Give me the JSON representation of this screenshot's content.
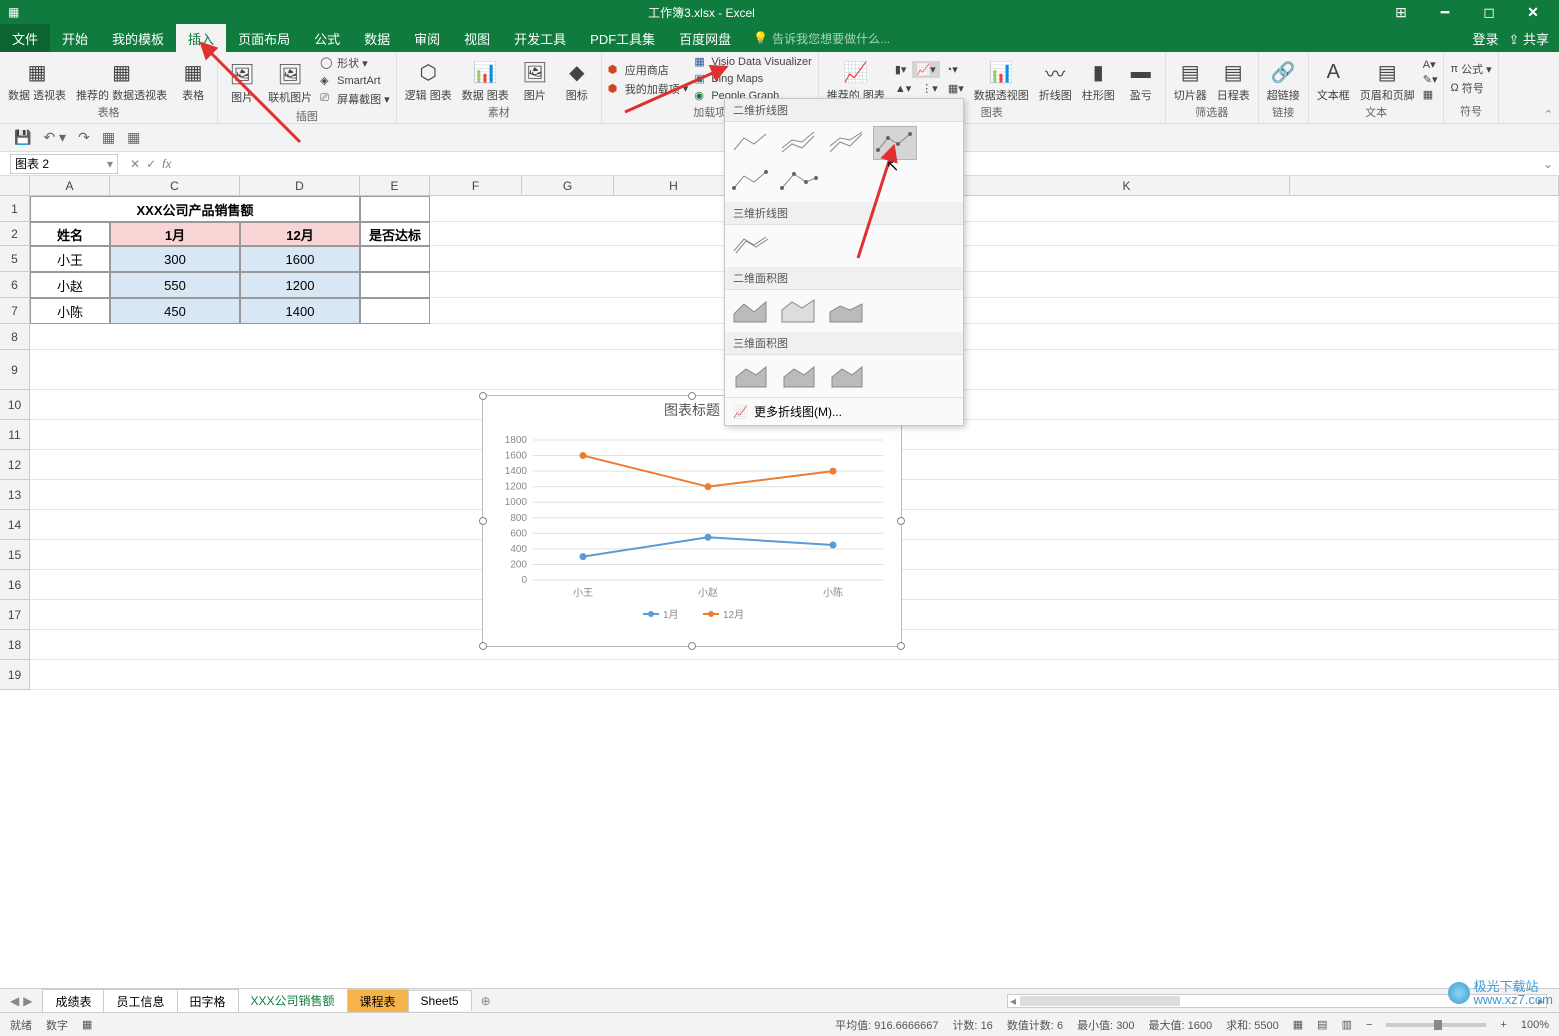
{
  "titlebar": {
    "title": "工作簿3.xlsx - Excel",
    "login": "登录",
    "share": "共享"
  },
  "menu": {
    "file": "文件",
    "home": "开始",
    "template": "我的模板",
    "insert": "插入",
    "layout": "页面布局",
    "formulas": "公式",
    "data": "数据",
    "review": "审阅",
    "view": "视图",
    "developer": "开发工具",
    "pdf": "PDF工具集",
    "baidu": "百度网盘",
    "tellme": "告诉我您想要做什么..."
  },
  "ribbon": {
    "tables": {
      "pivot": "数据\n透视表",
      "rec_pivot": "推荐的\n数据透视表",
      "table": "表格",
      "group": "表格"
    },
    "illustrations": {
      "picture": "图片",
      "online_pic": "联机图片",
      "shapes": "形状",
      "smartart": "SmartArt",
      "screenshot": "屏幕截图",
      "group": "插图"
    },
    "material": {
      "logic": "逻辑\n图表",
      "data_chart": "数据\n图表",
      "img": "图片",
      "icon": "图标",
      "group": "素材"
    },
    "addins": {
      "store": "应用商店",
      "myaddins": "我的加载项",
      "visio": "Visio Data Visualizer",
      "bing": "Bing Maps",
      "people": "People Graph",
      "group": "加载项"
    },
    "charts": {
      "recommended": "推荐的\n图表",
      "pivot_chart": "数据透视图",
      "line": "折线图",
      "bar": "柱形图",
      "win": "盈亏",
      "group": "图表"
    },
    "filters": {
      "slicer": "切片器",
      "timeline": "日程表",
      "group": "筛选器"
    },
    "links": {
      "hyperlink": "超链接",
      "group": "链接"
    },
    "text": {
      "textbox": "文本框",
      "header": "页眉和页脚",
      "group": "文本"
    },
    "symbols": {
      "formula": "公式",
      "symbol": "符号",
      "group": "符号"
    }
  },
  "namebox": "图表 2",
  "dropdown": {
    "s1": "二维折线图",
    "s2": "三维折线图",
    "s3": "二维面积图",
    "s4": "三维面积图",
    "more": "更多折线图(M)..."
  },
  "sheet_data": {
    "title": "XXX公司产品销售额",
    "headers": {
      "name": "姓名",
      "m1": "1月",
      "m12": "12月",
      "pass": "是否达标"
    },
    "rows": [
      {
        "name": "小王",
        "m1": "300",
        "m12": "1600"
      },
      {
        "name": "小赵",
        "m1": "550",
        "m12": "1200"
      },
      {
        "name": "小陈",
        "m1": "450",
        "m12": "1400"
      }
    ]
  },
  "chart_data": {
    "type": "line",
    "title": "图表标题",
    "categories": [
      "小王",
      "小赵",
      "小陈"
    ],
    "series": [
      {
        "name": "1月",
        "values": [
          300,
          550,
          450
        ],
        "color": "#5b9bd5"
      },
      {
        "name": "12月",
        "values": [
          1600,
          1200,
          1400
        ],
        "color": "#ed7d31"
      }
    ],
    "ylim": [
      0,
      1800
    ],
    "ystep": 200
  },
  "sheets": {
    "s1": "成绩表",
    "s2": "员工信息",
    "s3": "田字格",
    "s4": "XXX公司销售额",
    "s5": "课程表",
    "s6": "Sheet5"
  },
  "status": {
    "ready": "就绪",
    "num": "数字",
    "avg_l": "平均值:",
    "avg_v": "916.6666667",
    "cnt_l": "计数:",
    "cnt_v": "16",
    "ncnt_l": "数值计数:",
    "ncnt_v": "6",
    "min_l": "最小值:",
    "min_v": "300",
    "max_l": "最大值:",
    "max_v": "1600",
    "sum_l": "求和:",
    "sum_v": "5500",
    "zoom": "100%"
  },
  "watermark": "极光下载站\nwww.xz7.com",
  "col_letters": [
    "A",
    "C",
    "D",
    "E",
    "F",
    "G",
    "H",
    "K"
  ],
  "row_nums": [
    "1",
    "2",
    "5",
    "6",
    "7",
    "8",
    "9",
    "10",
    "11",
    "12",
    "13",
    "14",
    "15",
    "16",
    "17",
    "18",
    "19"
  ]
}
